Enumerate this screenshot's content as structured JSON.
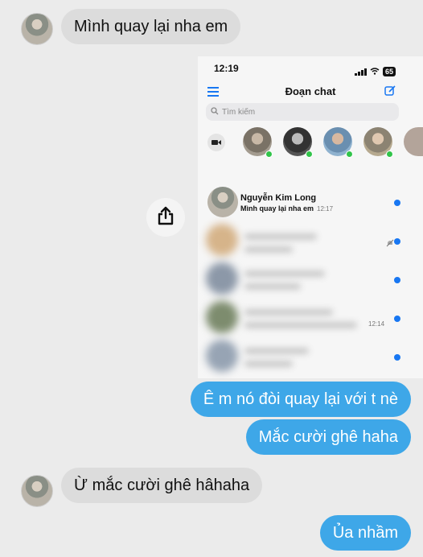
{
  "messages": {
    "m1": "Mình quay lại nha em",
    "m2": "Ê m nó đòi quay lại với t nè",
    "m3": "Mắc cười ghê haha",
    "m4": "Ừ mắc cười ghê hâhaha",
    "m5": "Ủa nhầm"
  },
  "phone": {
    "status_time": "12:19",
    "battery": "65",
    "title": "Đoạn chat",
    "search_placeholder": "Tìm kiếm",
    "chat": {
      "name": "Nguyễn Kim Long",
      "message": "Mình quay lại nha em",
      "time": "12:17"
    },
    "blurred_time": "12:14"
  },
  "colors": {
    "outgoing_bubble": "#3ea7e8",
    "incoming_bubble": "#dcdcdc",
    "messenger_blue": "#1877f2",
    "online_green": "#31c44a"
  },
  "icons": [
    "share-icon",
    "menu-icon",
    "edit-icon",
    "search-icon",
    "video-camera-icon",
    "wifi-icon",
    "signal-icon",
    "mute-icon"
  ]
}
